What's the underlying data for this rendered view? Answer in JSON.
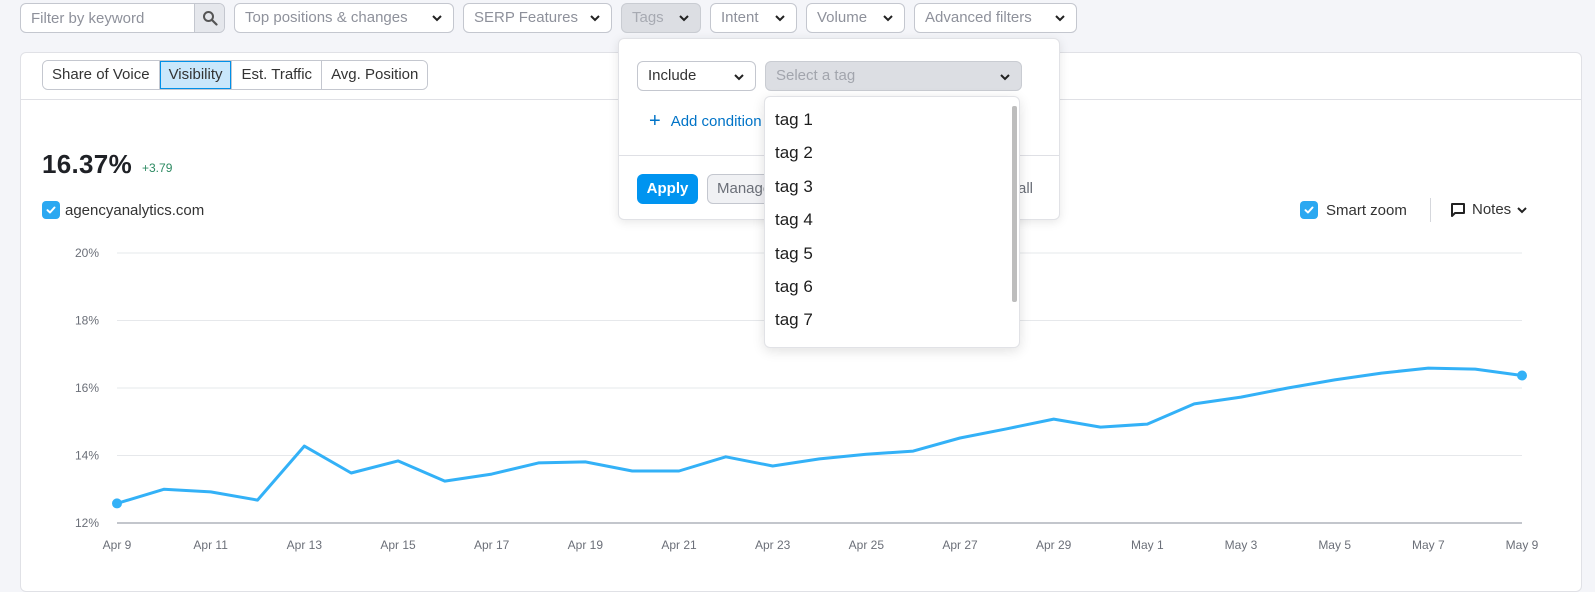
{
  "filters": {
    "search_placeholder": "Filter by keyword",
    "search_icon": "search-icon",
    "top_positions_label": "Top positions & changes",
    "serp_features_label": "SERP Features",
    "tags_label": "Tags",
    "intent_label": "Intent",
    "volume_label": "Volume",
    "advanced_label": "Advanced filters"
  },
  "metric_tabs": [
    {
      "label": "Share of Voice",
      "active": false
    },
    {
      "label": "Visibility",
      "active": true
    },
    {
      "label": "Est. Traffic",
      "active": false
    },
    {
      "label": "Avg. Position",
      "active": false
    }
  ],
  "summary": {
    "value": "16.37%",
    "delta": "+3.79",
    "delta_color": "#2d8a62"
  },
  "legend": {
    "domain": "agencyanalytics.com",
    "checked": true
  },
  "controls": {
    "smart_zoom_label": "Smart zoom",
    "smart_zoom_checked": true,
    "notes_label": "Notes"
  },
  "tags_panel": {
    "include_value": "Include",
    "tag_placeholder": "Select a tag",
    "add_condition_label": "Add condition",
    "apply_label": "Apply",
    "manage_label": "Manage tags",
    "clear_label": "Clear all",
    "tag_options": [
      "tag 1",
      "tag 2",
      "tag 3",
      "tag 4",
      "tag 5",
      "tag 6",
      "tag 7"
    ]
  },
  "colors": {
    "line": "#33b1f7",
    "accent": "#0094f0",
    "active_tab_bg": "#c9e7fb"
  },
  "chart_data": {
    "type": "line",
    "title": "",
    "xlabel": "",
    "ylabel": "Visibility",
    "ylim": [
      12,
      20
    ],
    "yticks": [
      12,
      14,
      16,
      18,
      20
    ],
    "ytick_labels": [
      "12%",
      "14%",
      "16%",
      "18%",
      "20%"
    ],
    "grid": true,
    "x": [
      "Apr 9",
      "Apr 10",
      "Apr 11",
      "Apr 12",
      "Apr 13",
      "Apr 14",
      "Apr 15",
      "Apr 16",
      "Apr 17",
      "Apr 18",
      "Apr 19",
      "Apr 20",
      "Apr 21",
      "Apr 22",
      "Apr 23",
      "Apr 24",
      "Apr 25",
      "Apr 26",
      "Apr 27",
      "Apr 28",
      "Apr 29",
      "Apr 30",
      "May 1",
      "May 2",
      "May 3",
      "May 4",
      "May 5",
      "May 6",
      "May 7",
      "May 8",
      "May 9"
    ],
    "xtick_labels": [
      "Apr 9",
      "Apr 11",
      "Apr 13",
      "Apr 15",
      "Apr 17",
      "Apr 19",
      "Apr 21",
      "Apr 23",
      "Apr 25",
      "Apr 27",
      "Apr 29",
      "May 1",
      "May 3",
      "May 5",
      "May 7",
      "May 9"
    ],
    "series": [
      {
        "name": "agencyanalytics.com",
        "values": [
          12.58,
          13.0,
          12.92,
          12.68,
          14.28,
          13.48,
          13.84,
          13.24,
          13.45,
          13.78,
          13.81,
          13.54,
          13.54,
          13.96,
          13.69,
          13.9,
          14.04,
          14.13,
          14.52,
          14.79,
          15.08,
          14.84,
          14.93,
          15.53,
          15.73,
          16.0,
          16.24,
          16.44,
          16.59,
          16.56,
          16.37
        ]
      }
    ]
  }
}
